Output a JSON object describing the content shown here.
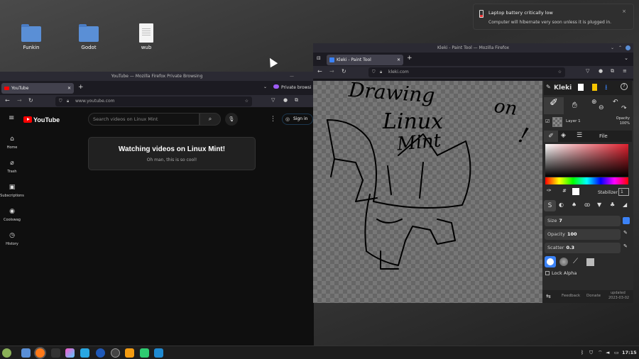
{
  "desktop": {
    "icons": [
      {
        "label": "Funkin",
        "kind": "folder-icon"
      },
      {
        "label": "Godot",
        "kind": "folder-icon"
      },
      {
        "label": "wub",
        "kind": "text-file-icon"
      }
    ]
  },
  "notification": {
    "title": "Laptop battery critically low",
    "body": "Computer will hibernate very soon unless it is plugged in.",
    "close": "×"
  },
  "youtube_window": {
    "title": "YouTube — Mozilla Firefox Private Browsing",
    "tab_label": "YouTube",
    "tab2_label": "Private browsi",
    "url": "www.youtube.com",
    "logo": "YouTube",
    "search_placeholder": "Search videos on Linux Mint",
    "sign_in": "Sign in",
    "sidebar": [
      {
        "label": "Home",
        "icon": "home-icon",
        "glyph": "⌂"
      },
      {
        "label": "Trash",
        "icon": "trash-icon",
        "glyph": "⌀"
      },
      {
        "label": "Subscriptions",
        "icon": "subscriptions-icon",
        "glyph": "▣"
      },
      {
        "label": "Coolswag",
        "icon": "account-icon",
        "glyph": "◉"
      },
      {
        "label": "History",
        "icon": "history-icon",
        "glyph": "◷"
      }
    ],
    "card_heading": "Watching videos on Linux Mint!",
    "card_sub": "Oh man, this is so cool!"
  },
  "kleki_window": {
    "title": "Kleki - Paint Tool — Mozilla Firefox",
    "tab_label": "Kleki - Paint Tool",
    "url": "kleki.com",
    "logo": "Kleki",
    "layer_name": "Layer 1",
    "opacity_label": "Opacity",
    "opacity_value": "100%",
    "file_tab": "File",
    "stabilizer_label": "Stabilizer",
    "stabilizer_value": "1",
    "size_label": "Size",
    "size_value": "7",
    "brush_opacity_label": "Opacity",
    "brush_opacity_value": "100",
    "scatter_label": "Scatter",
    "scatter_value": "0.3",
    "lock_alpha": "Lock Alpha",
    "feedback": "Feedback",
    "donate": "Donate",
    "updated_label": "updated",
    "updated_date": "2023-03-02",
    "canvas_text": [
      "Drawing",
      "on",
      "Linux",
      "Mint",
      "!"
    ]
  },
  "taskbar": {
    "clock": "17:15",
    "colors": {
      "mint": "#8bb158",
      "firefox": "#ff7a1a",
      "accent": "#3b82f6"
    }
  }
}
